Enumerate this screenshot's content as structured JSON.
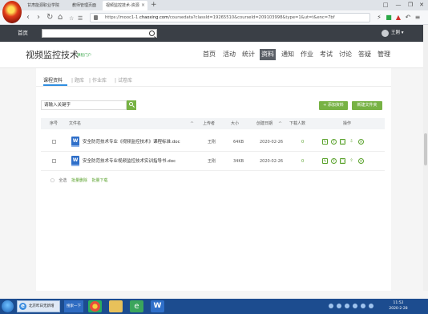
{
  "browser": {
    "tabs": [
      {
        "label": "甘肃能源职业学院"
      },
      {
        "label": "教师管理页面"
      },
      {
        "label": "视频监控技术-资源"
      }
    ],
    "address": {
      "prefix": "https://mooc1-1.",
      "domain": "chaoxing.com",
      "rest": "/coursedata?classId=19265510&courseId=209103998&type=1&ut=t&enc=7bf"
    },
    "window_controls": [
      "□",
      "—",
      "❐",
      "✕"
    ],
    "nav": {
      "back": "‹",
      "forward": "›",
      "reload": "↻",
      "home": "⌂"
    }
  },
  "site_header": {
    "home": "首页",
    "user": "王刚"
  },
  "course": {
    "title": "视频监控技术",
    "subtitle": "课程门户",
    "nav": [
      "首页",
      "活动",
      "统计",
      "资料",
      "通知",
      "作业",
      "考试",
      "讨论",
      "答疑",
      "管理"
    ],
    "active_nav": "资料"
  },
  "subtabs": [
    "课程资料",
    "题库",
    "作业库",
    "试卷库"
  ],
  "search": {
    "placeholder": "请输入关键字"
  },
  "buttons": {
    "add": "+ 添加资料",
    "new_folder": "新建文件夹"
  },
  "table": {
    "headers": [
      "序号",
      "文件名",
      "上传者",
      "大小",
      "创建日期",
      "下载人数",
      "操作"
    ],
    "rows": [
      {
        "icon": "W",
        "name": "安全防范技术专业《视频监控技术》课程标准.doc",
        "uploader": "王刚",
        "size": "64KB",
        "date": "2020-02-26",
        "downloads": "0"
      },
      {
        "icon": "W",
        "name": "安全防范技术专业视频监控技术实训指导书.doc",
        "uploader": "王刚",
        "size": "34KB",
        "date": "2020-02-26",
        "downloads": "0"
      }
    ],
    "sort_mark": "^"
  },
  "bulk": {
    "select_all": "全选",
    "delete": "批量删除",
    "download": "批量下载"
  },
  "taskbar": {
    "browser_label": "北京昨日无新增",
    "search_label": "搜索一下",
    "time": "11:52",
    "date": "2020-2-28"
  }
}
